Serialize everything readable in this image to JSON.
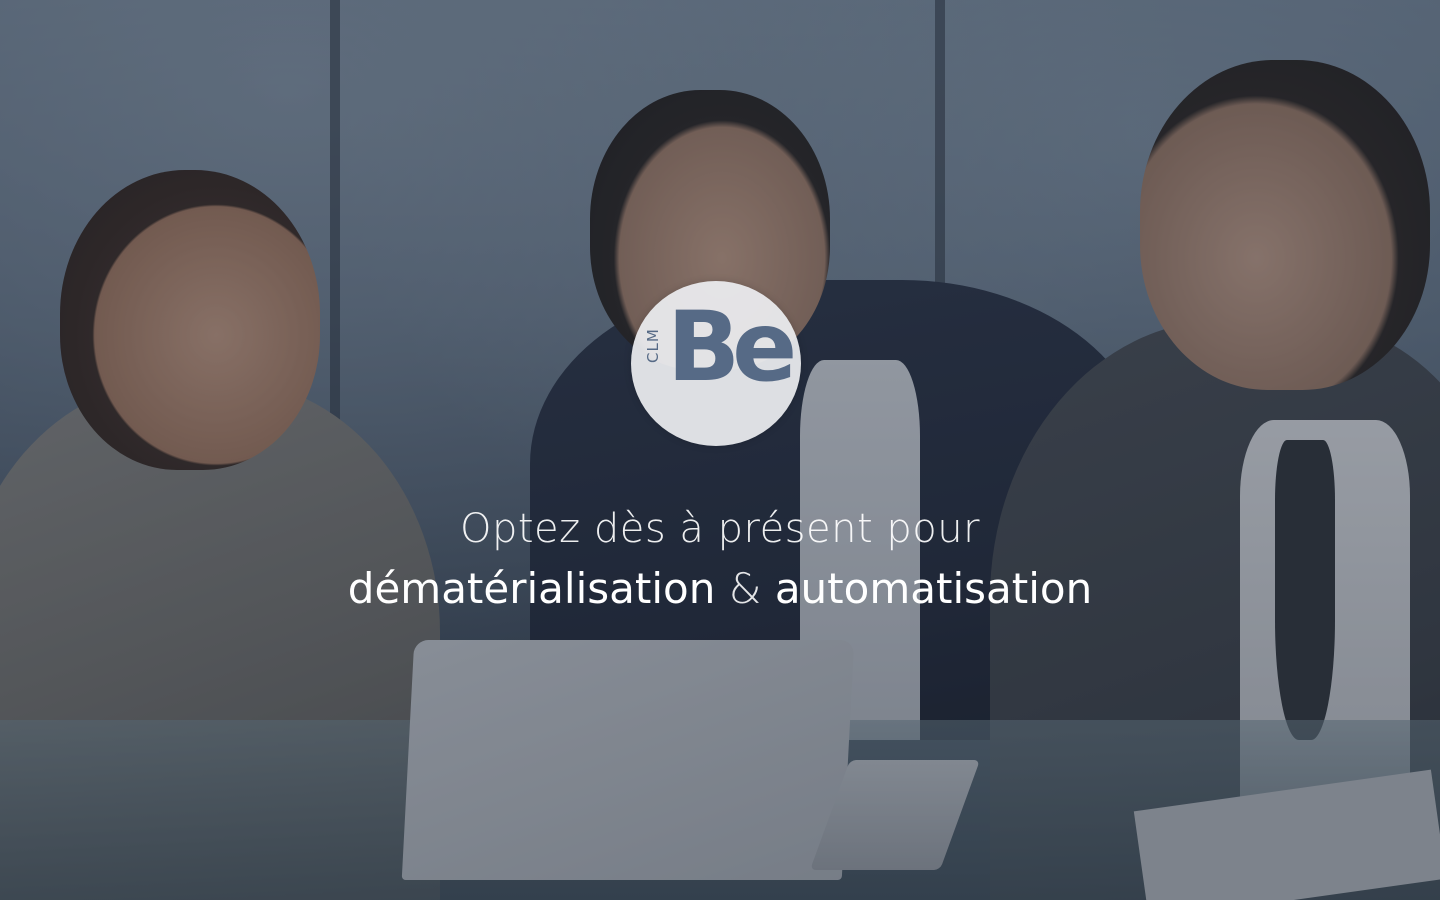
{
  "logo": {
    "clm": "CLM",
    "be": "Be",
    "color": "#566a86"
  },
  "tagline": {
    "line1": "Optez dès à présent pour",
    "word1": "dématérialisation",
    "amp": "&",
    "word2": "automatisation"
  },
  "colors": {
    "overlay": "#1e2837",
    "text": "#ffffff"
  }
}
